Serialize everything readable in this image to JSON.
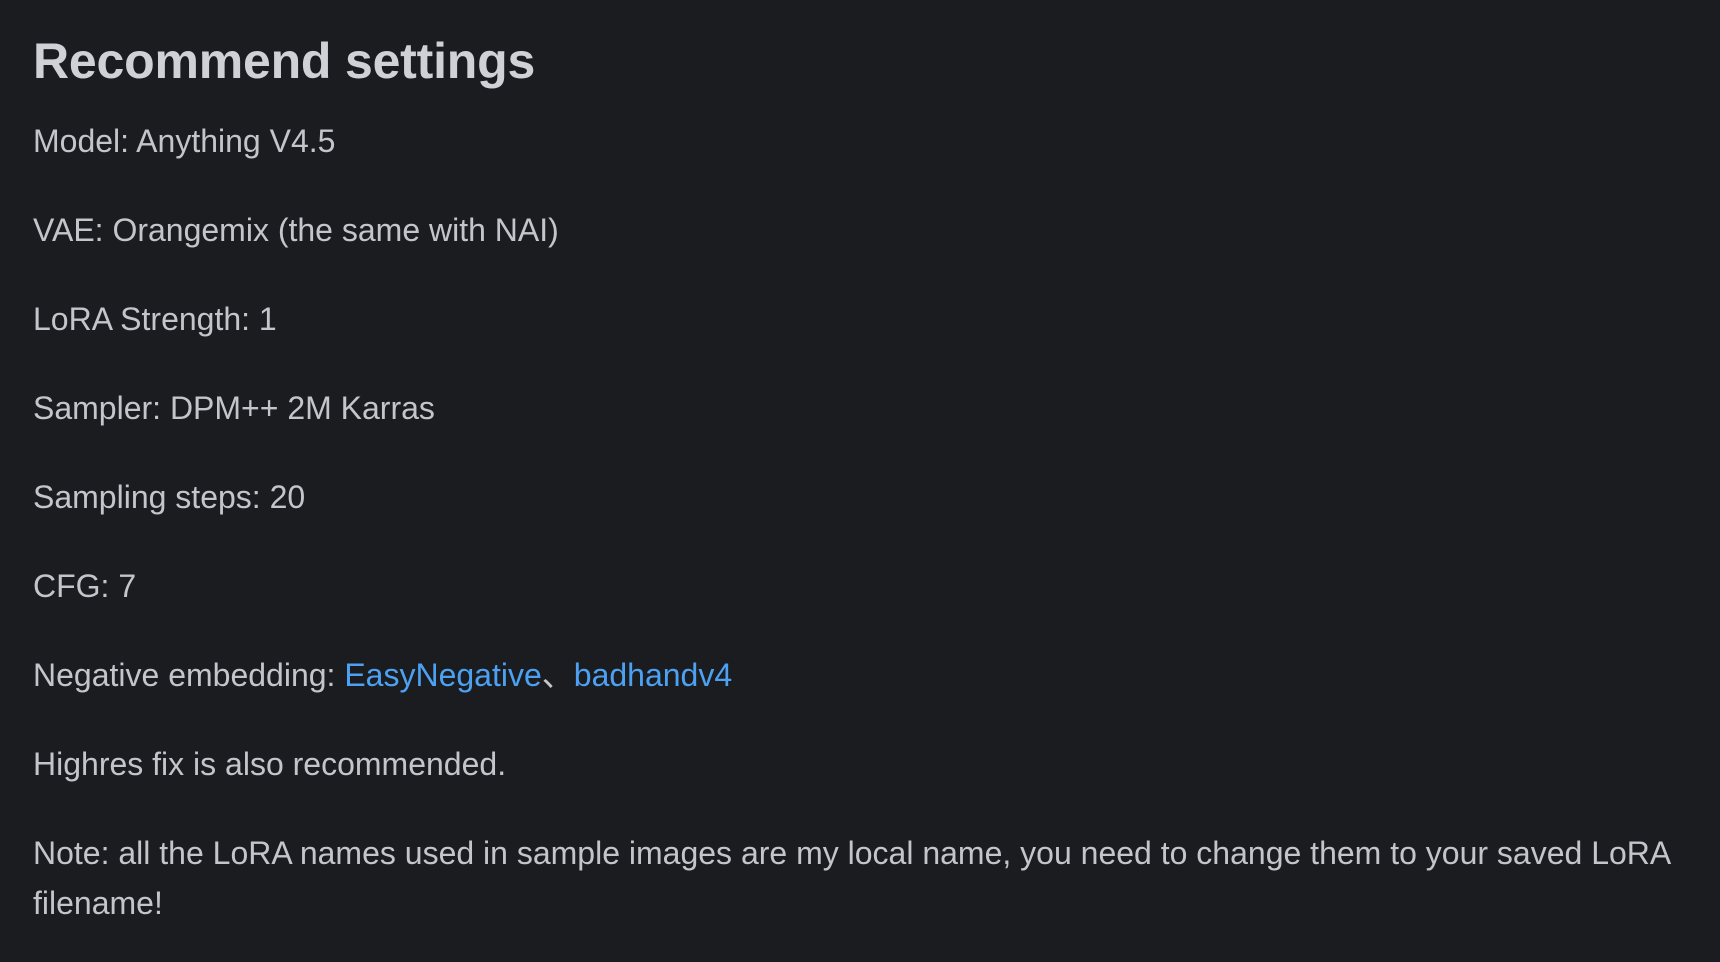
{
  "heading": "Recommend settings",
  "settings": {
    "model": "Model: Anything V4.5",
    "vae": "VAE: Orangemix (the same with NAI)",
    "lora_strength": "LoRA Strength: 1",
    "sampler": "Sampler: DPM++ 2M Karras",
    "sampling_steps": "Sampling steps: 20",
    "cfg": "CFG: 7"
  },
  "negative_embedding": {
    "label": "Negative embedding: ",
    "links": [
      "EasyNegative",
      "badhandv4"
    ],
    "separator": "、"
  },
  "highres_note": "Highres fix is also recommended.",
  "note": "Note: all the LoRA names used in sample images are my local name, you need to change them to your saved LoRA filename!",
  "colors": {
    "background": "#1b1c20",
    "text": "#c3c5cb",
    "link": "#4ca1f2"
  }
}
